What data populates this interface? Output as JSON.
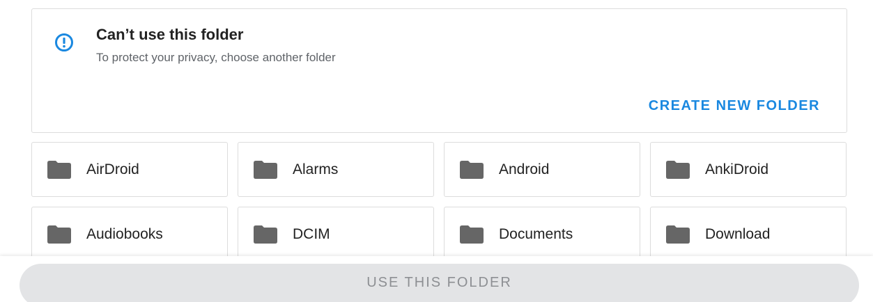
{
  "notice": {
    "icon": "info-circle-icon",
    "title": "Can’t use this folder",
    "subtitle": "To protect your privacy, choose another folder",
    "create_label": "CREATE NEW FOLDER",
    "accent": "#1a88e0"
  },
  "folders": [
    {
      "name": "AirDroid",
      "icon": "folder-icon"
    },
    {
      "name": "Alarms",
      "icon": "folder-icon"
    },
    {
      "name": "Android",
      "icon": "folder-icon"
    },
    {
      "name": "AnkiDroid",
      "icon": "folder-icon"
    },
    {
      "name": "Audiobooks",
      "icon": "folder-icon"
    },
    {
      "name": "DCIM",
      "icon": "folder-icon"
    },
    {
      "name": "Documents",
      "icon": "folder-icon"
    },
    {
      "name": "Download",
      "icon": "folder-icon"
    }
  ],
  "footer": {
    "use_label": "USE THIS FOLDER",
    "disabled": true
  }
}
